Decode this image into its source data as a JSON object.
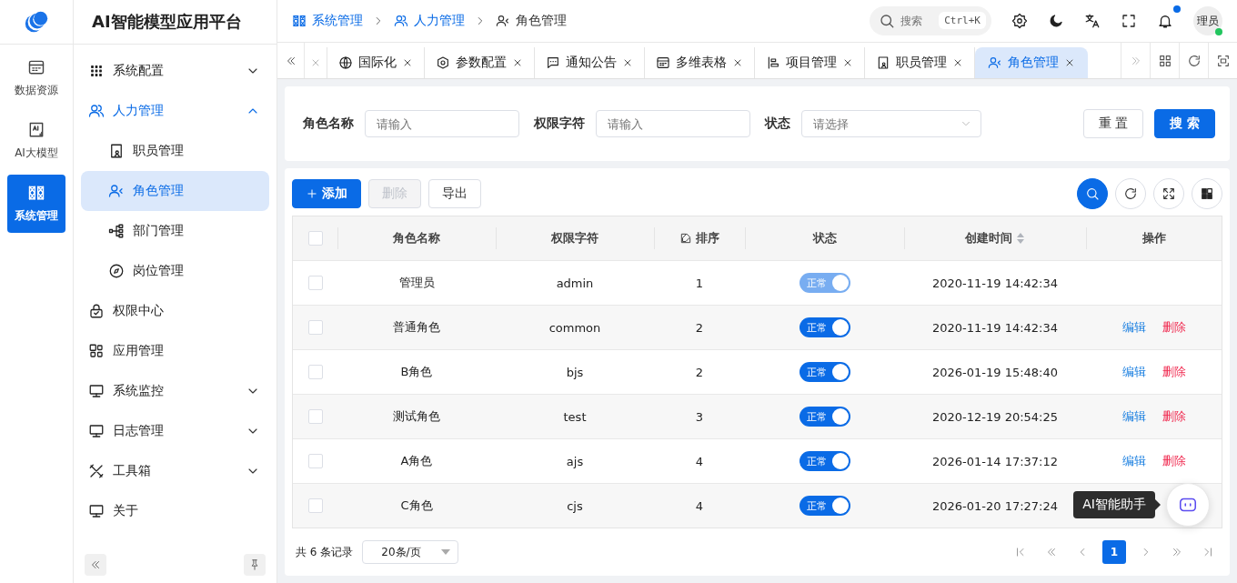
{
  "rail": {
    "items": [
      {
        "label": "数据资源",
        "selected": false
      },
      {
        "label": "AI大模型",
        "selected": false
      },
      {
        "label": "系统管理",
        "selected": true
      }
    ]
  },
  "app_title": "AI智能模型应用平台",
  "breadcrumb": [
    {
      "label": "系统管理",
      "link": true
    },
    {
      "label": "人力管理",
      "link": true
    },
    {
      "label": "角色管理",
      "link": false
    }
  ],
  "search": {
    "placeholder": "搜索",
    "shortcut": "Ctrl+K"
  },
  "notification_unread": true,
  "avatar": {
    "text": "理员",
    "online": true
  },
  "menu": [
    {
      "label": "系统配置",
      "expanded": false
    },
    {
      "label": "人力管理",
      "expanded": true,
      "children": [
        {
          "label": "职员管理",
          "selected": false
        },
        {
          "label": "角色管理",
          "selected": true
        },
        {
          "label": "部门管理",
          "selected": false
        },
        {
          "label": "岗位管理",
          "selected": false
        }
      ]
    },
    {
      "label": "权限中心"
    },
    {
      "label": "应用管理"
    },
    {
      "label": "系统监控",
      "expanded": false
    },
    {
      "label": "日志管理",
      "expanded": false
    },
    {
      "label": "工具箱",
      "expanded": false
    },
    {
      "label": "关于"
    }
  ],
  "tabs": [
    {
      "selected": false
    },
    {
      "label": "国际化",
      "selected": false
    },
    {
      "label": "参数配置",
      "selected": false
    },
    {
      "label": "通知公告",
      "selected": false
    },
    {
      "label": "多维表格",
      "selected": false
    },
    {
      "label": "项目管理",
      "selected": false
    },
    {
      "label": "职员管理",
      "selected": false
    },
    {
      "label": "角色管理",
      "selected": true
    }
  ],
  "filters": [
    {
      "label": "角色名称",
      "placeholder": "请输入",
      "kind": "input"
    },
    {
      "label": "权限字符",
      "placeholder": "请输入",
      "kind": "input"
    },
    {
      "label": "状态",
      "placeholder": "请选择",
      "kind": "select"
    }
  ],
  "filter_buttons": [
    {
      "label": "重 置",
      "kind": "default"
    },
    {
      "label": "搜 索",
      "kind": "primary"
    }
  ],
  "toolbar": [
    {
      "label": "添加",
      "kind": "primary",
      "disabled": false
    },
    {
      "label": "删除",
      "kind": "default",
      "disabled": true
    },
    {
      "label": "导出",
      "kind": "default",
      "disabled": false
    }
  ],
  "table": {
    "header_checked": false,
    "columns": [
      {
        "label": "角色名称",
        "kind": "plain"
      },
      {
        "label": "权限字符",
        "kind": "plain"
      },
      {
        "label": "排序",
        "kind": "editable"
      },
      {
        "label": "状态",
        "kind": "plain"
      },
      {
        "label": "创建时间",
        "kind": "sortable"
      },
      {
        "label": "操作",
        "kind": "plain"
      }
    ],
    "rows": [
      {
        "checked": false,
        "name": "管理员",
        "key": "admin",
        "order": "1",
        "status": {
          "text": "正常",
          "on": true,
          "disabled": true
        },
        "created": "2020-11-19 14:42:34"
      },
      {
        "checked": false,
        "name": "普通角色",
        "key": "common",
        "order": "2",
        "status": {
          "text": "正常",
          "on": true,
          "disabled": false
        },
        "created": "2020-11-19 14:42:34",
        "actions": [
          {
            "label": "编辑",
            "kind": "edit"
          },
          {
            "label": "删除",
            "kind": "danger"
          }
        ]
      },
      {
        "checked": false,
        "name": "B角色",
        "key": "bjs",
        "order": "2",
        "status": {
          "text": "正常",
          "on": true,
          "disabled": false
        },
        "created": "2026-01-19 15:48:40",
        "actions": [
          {
            "label": "编辑",
            "kind": "edit"
          },
          {
            "label": "删除",
            "kind": "danger"
          }
        ]
      },
      {
        "checked": false,
        "name": "测试角色",
        "key": "test",
        "order": "3",
        "status": {
          "text": "正常",
          "on": true,
          "disabled": false
        },
        "created": "2020-12-19 20:54:25",
        "actions": [
          {
            "label": "编辑",
            "kind": "edit"
          },
          {
            "label": "删除",
            "kind": "danger"
          }
        ]
      },
      {
        "checked": false,
        "name": "A角色",
        "key": "ajs",
        "order": "4",
        "status": {
          "text": "正常",
          "on": true,
          "disabled": false
        },
        "created": "2026-01-14 17:37:12",
        "actions": [
          {
            "label": "编辑",
            "kind": "edit"
          },
          {
            "label": "删除",
            "kind": "danger"
          }
        ]
      },
      {
        "checked": false,
        "name": "C角色",
        "key": "cjs",
        "order": "4",
        "status": {
          "text": "正常",
          "on": true,
          "disabled": false
        },
        "created": "2026-01-20 17:27:24"
      }
    ]
  },
  "pagination": {
    "total": "共 6 条记录",
    "page_size": "20条/页",
    "pages": [
      {
        "label": "1",
        "selected": true
      }
    ]
  },
  "assistant": {
    "tooltip": "AI智能助手"
  }
}
